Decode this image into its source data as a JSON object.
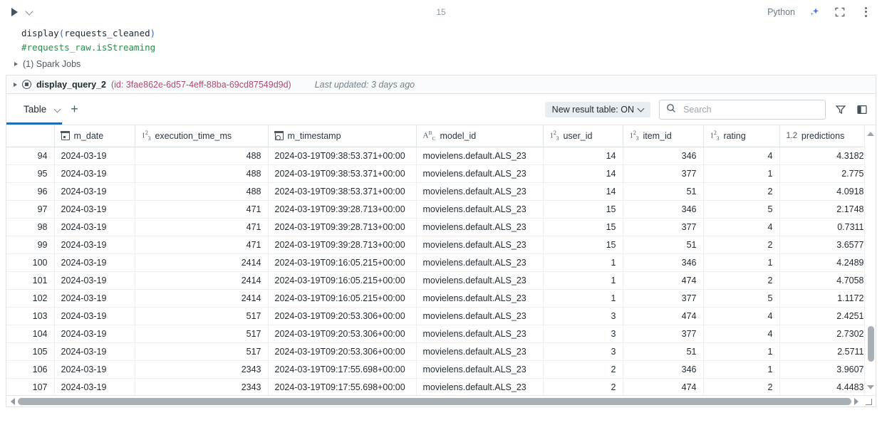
{
  "cell": {
    "run_icon": "play-icon",
    "dropdown_icon": "chevron-down-icon",
    "cell_index": "15",
    "language": "Python",
    "ai_icon": "sparkle-icon",
    "fullscreen_icon": "fullscreen-icon",
    "more_icon": "more-vertical-icon"
  },
  "code": {
    "line1_a": "display",
    "line1_open": "(",
    "line1_b": "requests_cleaned",
    "line1_close": ")",
    "line2": "#requests_raw.isStreaming"
  },
  "spark_jobs": {
    "label": "(1) Spark Jobs"
  },
  "query_status": {
    "name": "display_query_2",
    "id": "(id: 3fae862e-6d57-4eff-88ba-69cd87549d9d)",
    "last_updated": "Last updated: 3 days ago",
    "stop_icon": "stop-circle-icon",
    "expand_icon": "triangle-right-icon"
  },
  "result_toolbar": {
    "tab_label": "Table",
    "tab_caret_icon": "chevron-down-icon",
    "add_tab_icon": "plus-icon",
    "new_result_table": "New result table: ON",
    "search_placeholder": "Search",
    "search_value": "",
    "search_icon": "search-icon",
    "filter_icon": "filter-icon",
    "panel_icon": "side-panel-icon",
    "accent_color": "#1e6eb8"
  },
  "table": {
    "columns": [
      {
        "label": "",
        "type": "rownum",
        "align": "right",
        "icon": ""
      },
      {
        "label": "m_date",
        "type": "date",
        "align": "left",
        "icon": "calendar-icon"
      },
      {
        "label": "execution_time_ms",
        "type": "int",
        "align": "right",
        "icon": "integer-type-icon"
      },
      {
        "label": "m_timestamp",
        "type": "timestamp",
        "align": "left",
        "icon": "calendar-clock-icon"
      },
      {
        "label": "model_id",
        "type": "string",
        "align": "left",
        "icon": "string-type-icon"
      },
      {
        "label": "user_id",
        "type": "int",
        "align": "right",
        "icon": "integer-type-icon"
      },
      {
        "label": "item_id",
        "type": "int",
        "align": "right",
        "icon": "integer-type-icon"
      },
      {
        "label": "rating",
        "type": "int",
        "align": "right",
        "icon": "integer-type-icon"
      },
      {
        "label": "predictions",
        "type": "float",
        "align": "right",
        "icon": "float-type-icon"
      }
    ],
    "rows": [
      [
        "94",
        "2024-03-19",
        "488",
        "2024-03-19T09:38:53.371+00:00",
        "movielens.default.ALS_23",
        "14",
        "346",
        "4",
        "4.3182"
      ],
      [
        "95",
        "2024-03-19",
        "488",
        "2024-03-19T09:38:53.371+00:00",
        "movielens.default.ALS_23",
        "14",
        "377",
        "1",
        "2.775"
      ],
      [
        "96",
        "2024-03-19",
        "488",
        "2024-03-19T09:38:53.371+00:00",
        "movielens.default.ALS_23",
        "14",
        "51",
        "2",
        "4.0918"
      ],
      [
        "97",
        "2024-03-19",
        "471",
        "2024-03-19T09:39:28.713+00:00",
        "movielens.default.ALS_23",
        "15",
        "346",
        "5",
        "2.1748"
      ],
      [
        "98",
        "2024-03-19",
        "471",
        "2024-03-19T09:39:28.713+00:00",
        "movielens.default.ALS_23",
        "15",
        "377",
        "4",
        "0.7311"
      ],
      [
        "99",
        "2024-03-19",
        "471",
        "2024-03-19T09:39:28.713+00:00",
        "movielens.default.ALS_23",
        "15",
        "51",
        "2",
        "3.6577"
      ],
      [
        "100",
        "2024-03-19",
        "2414",
        "2024-03-19T09:16:05.215+00:00",
        "movielens.default.ALS_23",
        "1",
        "346",
        "1",
        "4.2489"
      ],
      [
        "101",
        "2024-03-19",
        "2414",
        "2024-03-19T09:16:05.215+00:00",
        "movielens.default.ALS_23",
        "1",
        "474",
        "2",
        "4.7058"
      ],
      [
        "102",
        "2024-03-19",
        "2414",
        "2024-03-19T09:16:05.215+00:00",
        "movielens.default.ALS_23",
        "1",
        "377",
        "5",
        "1.1172"
      ],
      [
        "103",
        "2024-03-19",
        "517",
        "2024-03-19T09:20:53.306+00:00",
        "movielens.default.ALS_23",
        "3",
        "474",
        "4",
        "2.4251"
      ],
      [
        "104",
        "2024-03-19",
        "517",
        "2024-03-19T09:20:53.306+00:00",
        "movielens.default.ALS_23",
        "3",
        "377",
        "4",
        "2.7302"
      ],
      [
        "105",
        "2024-03-19",
        "517",
        "2024-03-19T09:20:53.306+00:00",
        "movielens.default.ALS_23",
        "3",
        "51",
        "1",
        "2.5711"
      ],
      [
        "106",
        "2024-03-19",
        "2343",
        "2024-03-19T09:17:55.698+00:00",
        "movielens.default.ALS_23",
        "2",
        "346",
        "1",
        "3.9607"
      ],
      [
        "107",
        "2024-03-19",
        "2343",
        "2024-03-19T09:17:55.698+00:00",
        "movielens.default.ALS_23",
        "2",
        "474",
        "2",
        "4.4483"
      ]
    ]
  },
  "scrollbars": {
    "v_up_icon": "scroll-up-arrow",
    "v_down_icon": "scroll-down-arrow",
    "h_left_icon": "scroll-left-arrow",
    "h_right_icon": "scroll-right-arrow",
    "resize_icon": "resize-corner-icon"
  }
}
